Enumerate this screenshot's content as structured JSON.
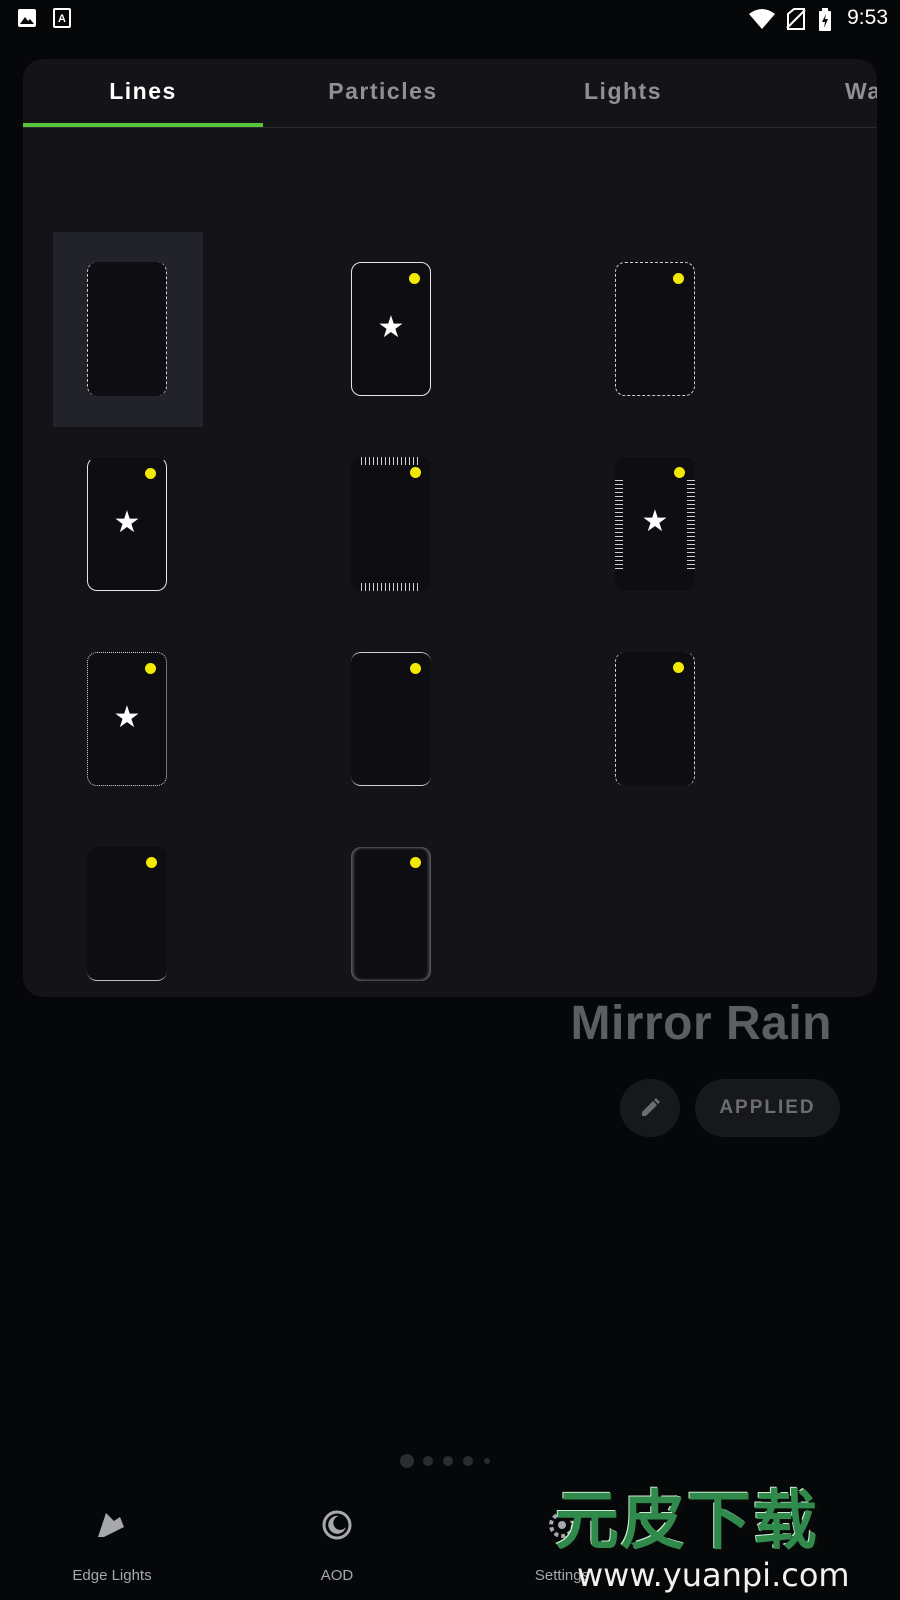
{
  "status_bar": {
    "time": "9:53",
    "icons": [
      "image-notification-icon",
      "font-notification-icon",
      "wifi-icon",
      "no-sim-icon",
      "battery-charging-icon"
    ]
  },
  "tabs": [
    {
      "label": "Lines",
      "active": true
    },
    {
      "label": "Particles",
      "active": false
    },
    {
      "label": "Lights",
      "active": false
    },
    {
      "label": "Waves",
      "active": false
    }
  ],
  "styles": [
    {
      "id": 1,
      "selected": true,
      "star": false,
      "dot": false
    },
    {
      "id": 2,
      "selected": false,
      "star": true,
      "dot": true
    },
    {
      "id": 3,
      "selected": false,
      "star": false,
      "dot": true
    },
    {
      "id": 4,
      "selected": false,
      "star": true,
      "dot": true
    },
    {
      "id": 5,
      "selected": false,
      "star": false,
      "dot": true
    },
    {
      "id": 6,
      "selected": false,
      "star": true,
      "dot": true
    },
    {
      "id": 7,
      "selected": false,
      "star": true,
      "dot": true
    },
    {
      "id": 8,
      "selected": false,
      "star": false,
      "dot": true
    },
    {
      "id": 9,
      "selected": false,
      "star": false,
      "dot": true
    },
    {
      "id": 10,
      "selected": false,
      "star": false,
      "dot": true
    },
    {
      "id": 11,
      "selected": false,
      "star": false,
      "dot": true
    }
  ],
  "glyphs": {
    "star": "★"
  },
  "preview": {
    "title": "Mirror Rain",
    "applied_label": "APPLIED",
    "edit_icon": "pencil-icon"
  },
  "pager": {
    "count": 5,
    "active_index": 0
  },
  "bottom_nav": [
    {
      "label": "Edge Lights",
      "icon": "edge-lights-icon"
    },
    {
      "label": "AOD",
      "icon": "aod-moon-icon"
    },
    {
      "label": "Settings",
      "icon": "settings-icon"
    }
  ],
  "watermark": {
    "chinese": "元皮下载",
    "url": "www.yuanpi.com"
  },
  "colors": {
    "accent": "#5ac53a",
    "dot": "#f4ea00",
    "sheet_bg": "#141418",
    "page_bg": "#050709"
  }
}
